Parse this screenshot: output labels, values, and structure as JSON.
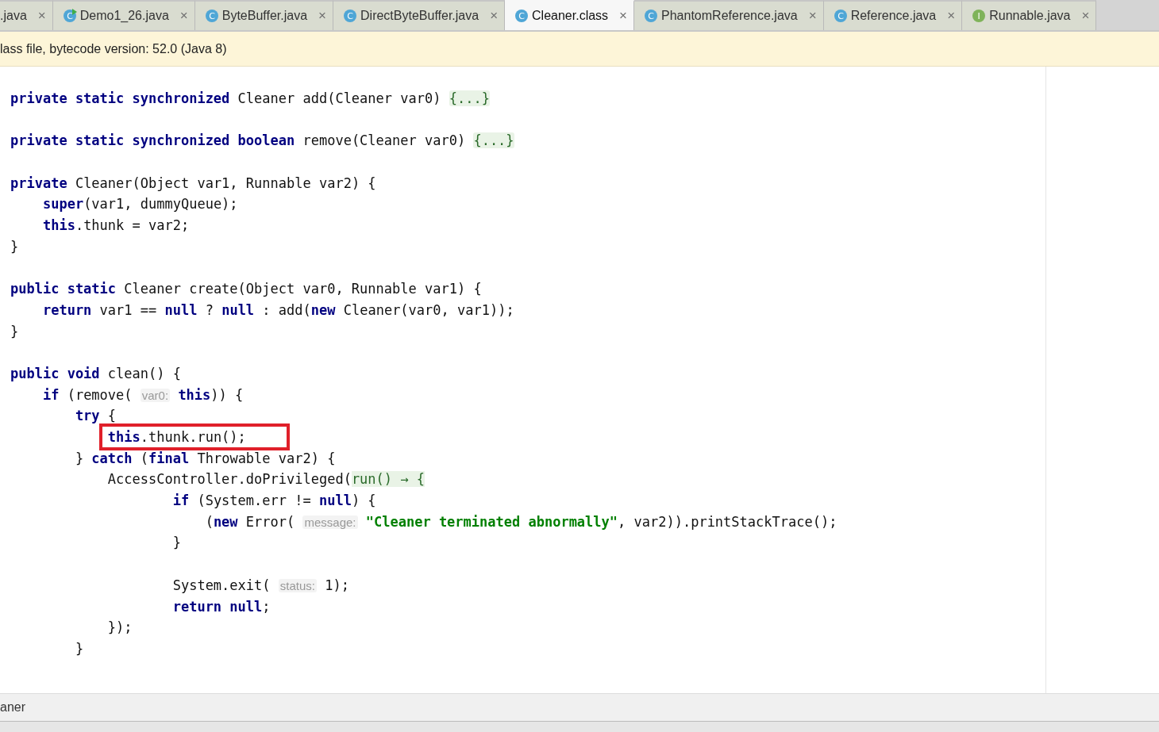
{
  "tabs": [
    {
      "label": ".java",
      "kind": "plain",
      "close": "×",
      "selected": false
    },
    {
      "label": "Demo1_26.java",
      "kind": "runnable",
      "icon_letter": "C",
      "close": "×",
      "selected": false
    },
    {
      "label": "ByteBuffer.java",
      "kind": "class",
      "icon_letter": "C",
      "close": "×",
      "selected": false
    },
    {
      "label": "DirectByteBuffer.java",
      "kind": "class",
      "icon_letter": "C",
      "close": "×",
      "selected": false
    },
    {
      "label": "Cleaner.class",
      "kind": "class",
      "icon_letter": "C",
      "close": "×",
      "selected": true
    },
    {
      "label": "PhantomReference.java",
      "kind": "class",
      "icon_letter": "C",
      "close": "×",
      "selected": false
    },
    {
      "label": "Reference.java",
      "kind": "class",
      "icon_letter": "C",
      "close": "×",
      "selected": false
    },
    {
      "label": "Runnable.java",
      "kind": "interface",
      "icon_letter": "I",
      "close": "×",
      "selected": false
    }
  ],
  "banner": "lass file, bytecode version: 52.0 (Java 8)",
  "code_lines": [
    {
      "highlighted": false,
      "tokens": [
        {
          "kind": "kw",
          "text": "private static synchronized"
        },
        {
          "kind": "plain",
          "text": " Cleaner add(Cleaner var0) "
        },
        {
          "kind": "fold",
          "text": "{...}"
        }
      ]
    },
    {
      "highlighted": false
    },
    {
      "highlighted": false,
      "tokens": [
        {
          "kind": "kw",
          "text": "private static synchronized boolean"
        },
        {
          "kind": "plain",
          "text": " remove(Cleaner var0) "
        },
        {
          "kind": "fold",
          "text": "{...}"
        }
      ]
    },
    {
      "highlighted": false
    },
    {
      "highlighted": false,
      "tokens": [
        {
          "kind": "kw",
          "text": "private"
        },
        {
          "kind": "plain",
          "text": " Cleaner(Object var1, Runnable var2) {"
        }
      ]
    },
    {
      "highlighted": false,
      "tokens": [
        {
          "kind": "kw",
          "text": "    super"
        },
        {
          "kind": "plain",
          "text": "(var1, dummyQueue);"
        }
      ]
    },
    {
      "highlighted": false,
      "tokens": [
        {
          "kind": "kw",
          "text": "    this"
        },
        {
          "kind": "plain",
          "text": ".thunk = var2;"
        }
      ]
    },
    {
      "highlighted": false,
      "tokens": [
        {
          "kind": "plain",
          "text": "}"
        }
      ]
    },
    {
      "highlighted": false
    },
    {
      "highlighted": false,
      "tokens": [
        {
          "kind": "kw",
          "text": "public static"
        },
        {
          "kind": "plain",
          "text": " Cleaner create(Object var0, Runnable var1) {"
        }
      ]
    },
    {
      "highlighted": false,
      "tokens": [
        {
          "kind": "kw",
          "text": "    return"
        },
        {
          "kind": "plain",
          "text": " var1 == "
        },
        {
          "kind": "kw",
          "text": "null"
        },
        {
          "kind": "plain",
          "text": " ? "
        },
        {
          "kind": "kw",
          "text": "null"
        },
        {
          "kind": "plain",
          "text": " : add("
        },
        {
          "kind": "kw",
          "text": "new"
        },
        {
          "kind": "plain",
          "text": " Cleaner(var0, var1));"
        }
      ]
    },
    {
      "highlighted": false,
      "tokens": [
        {
          "kind": "plain",
          "text": "}"
        }
      ]
    },
    {
      "highlighted": false
    },
    {
      "highlighted": false,
      "tokens": [
        {
          "kind": "kw",
          "text": "public void"
        },
        {
          "kind": "plain",
          "text": " clean() {"
        }
      ]
    },
    {
      "highlighted": false,
      "tokens": [
        {
          "kind": "kw",
          "text": "    if"
        },
        {
          "kind": "plain",
          "text": " (remove( "
        },
        {
          "kind": "hint",
          "text": "var0:"
        },
        {
          "kind": "kw",
          "text": " this"
        },
        {
          "kind": "plain",
          "text": ")) {"
        }
      ]
    },
    {
      "highlighted": false,
      "tokens": [
        {
          "kind": "kw",
          "text": "        try"
        },
        {
          "kind": "plain",
          "text": " {"
        }
      ]
    },
    {
      "highlighted": true,
      "tokens": [
        {
          "kind": "kw",
          "text": "            this"
        },
        {
          "kind": "plain",
          "text": ".thunk.run();"
        }
      ]
    },
    {
      "highlighted": false,
      "tokens": [
        {
          "kind": "plain",
          "text": "        } "
        },
        {
          "kind": "kw",
          "text": "catch"
        },
        {
          "kind": "plain",
          "text": " ("
        },
        {
          "kind": "kw",
          "text": "final"
        },
        {
          "kind": "plain",
          "text": " Throwable var2) {"
        }
      ]
    },
    {
      "highlighted": false,
      "tokens": [
        {
          "kind": "plain",
          "text": "            AccessController.doPrivileged("
        },
        {
          "kind": "lambda",
          "text": "run() → {"
        }
      ]
    },
    {
      "highlighted": false,
      "tokens": [
        {
          "kind": "kw",
          "text": "                    if"
        },
        {
          "kind": "plain",
          "text": " (System.err != "
        },
        {
          "kind": "kw",
          "text": "null"
        },
        {
          "kind": "plain",
          "text": ") {"
        }
      ]
    },
    {
      "highlighted": false,
      "tokens": [
        {
          "kind": "plain",
          "text": "                        ("
        },
        {
          "kind": "kw",
          "text": "new"
        },
        {
          "kind": "plain",
          "text": " Error( "
        },
        {
          "kind": "hint",
          "text": "message:"
        },
        {
          "kind": "str",
          "text": " \"Cleaner terminated abnormally\""
        },
        {
          "kind": "plain",
          "text": ", var2)).printStackTrace();"
        }
      ]
    },
    {
      "highlighted": false,
      "tokens": [
        {
          "kind": "plain",
          "text": "                    }"
        }
      ]
    },
    {
      "highlighted": false
    },
    {
      "highlighted": false,
      "tokens": [
        {
          "kind": "plain",
          "text": "                    System.exit( "
        },
        {
          "kind": "hint",
          "text": "status:"
        },
        {
          "kind": "plain",
          "text": " 1);"
        }
      ]
    },
    {
      "highlighted": false,
      "tokens": [
        {
          "kind": "kw",
          "text": "                    return null"
        },
        {
          "kind": "plain",
          "text": ";"
        }
      ]
    },
    {
      "highlighted": false,
      "tokens": [
        {
          "kind": "plain",
          "text": "            });"
        }
      ]
    },
    {
      "highlighted": false,
      "tokens": [
        {
          "kind": "plain",
          "text": "        }"
        }
      ]
    }
  ],
  "breadcrumb": "aner"
}
